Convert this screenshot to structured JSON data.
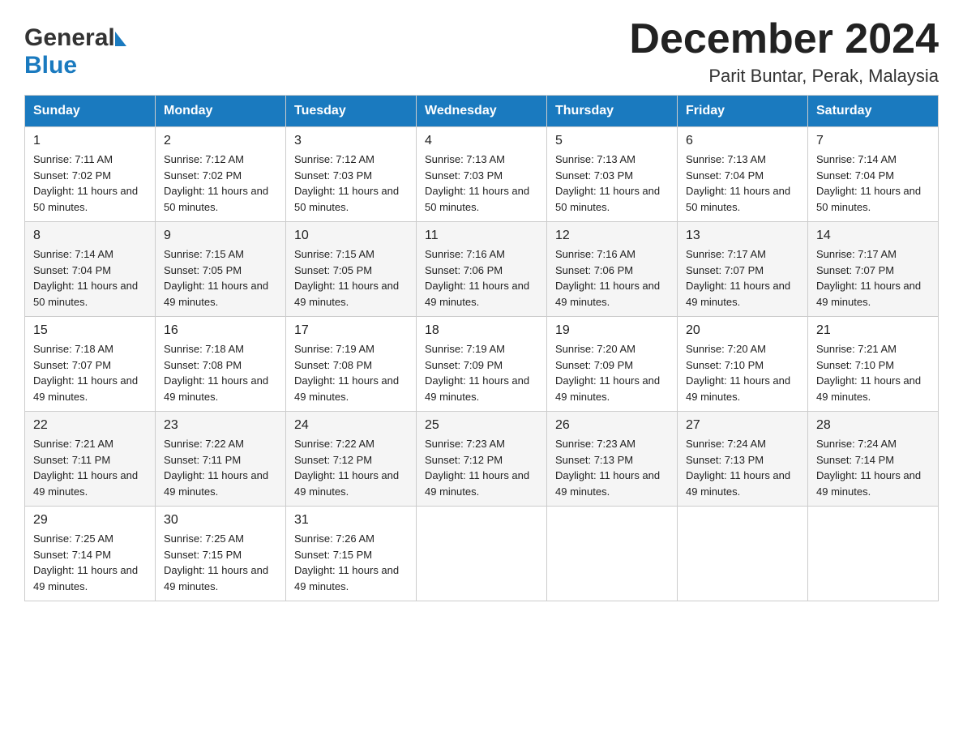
{
  "header": {
    "logo_general": "General",
    "logo_blue": "Blue",
    "month_title": "December 2024",
    "location": "Parit Buntar, Perak, Malaysia"
  },
  "days_of_week": [
    "Sunday",
    "Monday",
    "Tuesday",
    "Wednesday",
    "Thursday",
    "Friday",
    "Saturday"
  ],
  "weeks": [
    [
      {
        "day": "1",
        "sunrise": "7:11 AM",
        "sunset": "7:02 PM",
        "daylight": "11 hours and 50 minutes."
      },
      {
        "day": "2",
        "sunrise": "7:12 AM",
        "sunset": "7:02 PM",
        "daylight": "11 hours and 50 minutes."
      },
      {
        "day": "3",
        "sunrise": "7:12 AM",
        "sunset": "7:03 PM",
        "daylight": "11 hours and 50 minutes."
      },
      {
        "day": "4",
        "sunrise": "7:13 AM",
        "sunset": "7:03 PM",
        "daylight": "11 hours and 50 minutes."
      },
      {
        "day": "5",
        "sunrise": "7:13 AM",
        "sunset": "7:03 PM",
        "daylight": "11 hours and 50 minutes."
      },
      {
        "day": "6",
        "sunrise": "7:13 AM",
        "sunset": "7:04 PM",
        "daylight": "11 hours and 50 minutes."
      },
      {
        "day": "7",
        "sunrise": "7:14 AM",
        "sunset": "7:04 PM",
        "daylight": "11 hours and 50 minutes."
      }
    ],
    [
      {
        "day": "8",
        "sunrise": "7:14 AM",
        "sunset": "7:04 PM",
        "daylight": "11 hours and 50 minutes."
      },
      {
        "day": "9",
        "sunrise": "7:15 AM",
        "sunset": "7:05 PM",
        "daylight": "11 hours and 49 minutes."
      },
      {
        "day": "10",
        "sunrise": "7:15 AM",
        "sunset": "7:05 PM",
        "daylight": "11 hours and 49 minutes."
      },
      {
        "day": "11",
        "sunrise": "7:16 AM",
        "sunset": "7:06 PM",
        "daylight": "11 hours and 49 minutes."
      },
      {
        "day": "12",
        "sunrise": "7:16 AM",
        "sunset": "7:06 PM",
        "daylight": "11 hours and 49 minutes."
      },
      {
        "day": "13",
        "sunrise": "7:17 AM",
        "sunset": "7:07 PM",
        "daylight": "11 hours and 49 minutes."
      },
      {
        "day": "14",
        "sunrise": "7:17 AM",
        "sunset": "7:07 PM",
        "daylight": "11 hours and 49 minutes."
      }
    ],
    [
      {
        "day": "15",
        "sunrise": "7:18 AM",
        "sunset": "7:07 PM",
        "daylight": "11 hours and 49 minutes."
      },
      {
        "day": "16",
        "sunrise": "7:18 AM",
        "sunset": "7:08 PM",
        "daylight": "11 hours and 49 minutes."
      },
      {
        "day": "17",
        "sunrise": "7:19 AM",
        "sunset": "7:08 PM",
        "daylight": "11 hours and 49 minutes."
      },
      {
        "day": "18",
        "sunrise": "7:19 AM",
        "sunset": "7:09 PM",
        "daylight": "11 hours and 49 minutes."
      },
      {
        "day": "19",
        "sunrise": "7:20 AM",
        "sunset": "7:09 PM",
        "daylight": "11 hours and 49 minutes."
      },
      {
        "day": "20",
        "sunrise": "7:20 AM",
        "sunset": "7:10 PM",
        "daylight": "11 hours and 49 minutes."
      },
      {
        "day": "21",
        "sunrise": "7:21 AM",
        "sunset": "7:10 PM",
        "daylight": "11 hours and 49 minutes."
      }
    ],
    [
      {
        "day": "22",
        "sunrise": "7:21 AM",
        "sunset": "7:11 PM",
        "daylight": "11 hours and 49 minutes."
      },
      {
        "day": "23",
        "sunrise": "7:22 AM",
        "sunset": "7:11 PM",
        "daylight": "11 hours and 49 minutes."
      },
      {
        "day": "24",
        "sunrise": "7:22 AM",
        "sunset": "7:12 PM",
        "daylight": "11 hours and 49 minutes."
      },
      {
        "day": "25",
        "sunrise": "7:23 AM",
        "sunset": "7:12 PM",
        "daylight": "11 hours and 49 minutes."
      },
      {
        "day": "26",
        "sunrise": "7:23 AM",
        "sunset": "7:13 PM",
        "daylight": "11 hours and 49 minutes."
      },
      {
        "day": "27",
        "sunrise": "7:24 AM",
        "sunset": "7:13 PM",
        "daylight": "11 hours and 49 minutes."
      },
      {
        "day": "28",
        "sunrise": "7:24 AM",
        "sunset": "7:14 PM",
        "daylight": "11 hours and 49 minutes."
      }
    ],
    [
      {
        "day": "29",
        "sunrise": "7:25 AM",
        "sunset": "7:14 PM",
        "daylight": "11 hours and 49 minutes."
      },
      {
        "day": "30",
        "sunrise": "7:25 AM",
        "sunset": "7:15 PM",
        "daylight": "11 hours and 49 minutes."
      },
      {
        "day": "31",
        "sunrise": "7:26 AM",
        "sunset": "7:15 PM",
        "daylight": "11 hours and 49 minutes."
      },
      null,
      null,
      null,
      null
    ]
  ],
  "labels": {
    "sunrise": "Sunrise:",
    "sunset": "Sunset:",
    "daylight": "Daylight:"
  },
  "colors": {
    "header_bg": "#1a7abf",
    "header_text": "#ffffff",
    "border": "#cccccc"
  }
}
